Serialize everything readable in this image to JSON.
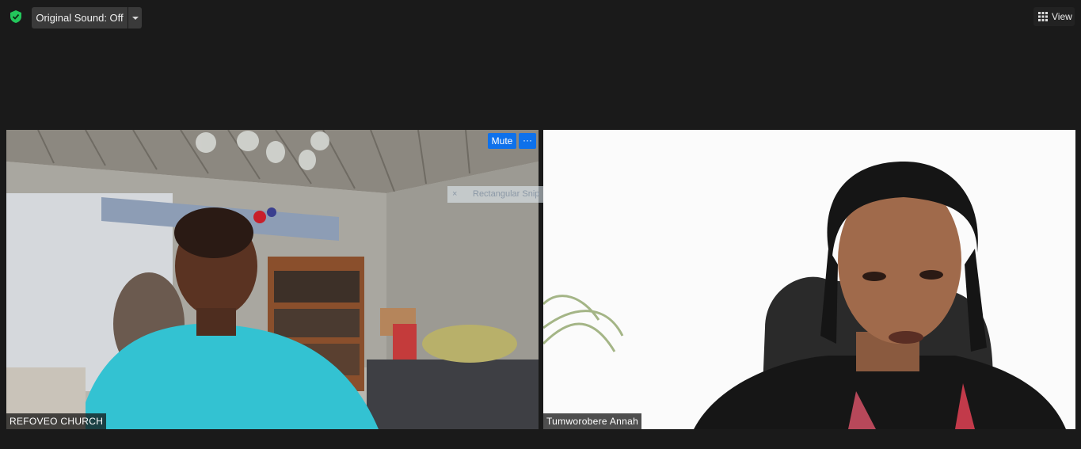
{
  "toolbar": {
    "original_sound_label": "Original Sound: Off",
    "view_label": "View",
    "icons": {
      "security": "shield-check-icon",
      "dropdown": "caret-down-icon",
      "view": "grid-icon"
    }
  },
  "participants": [
    {
      "name": "REFOVEO CHURCH",
      "mute_label": "Mute",
      "more_label": "···"
    },
    {
      "name": "Tumworobere Annah"
    }
  ],
  "overlay": {
    "close": "×",
    "text": "Rectangular Snip"
  },
  "colors": {
    "background": "#1a1a1a",
    "accent": "#0e71eb",
    "security": "#23c65b"
  }
}
